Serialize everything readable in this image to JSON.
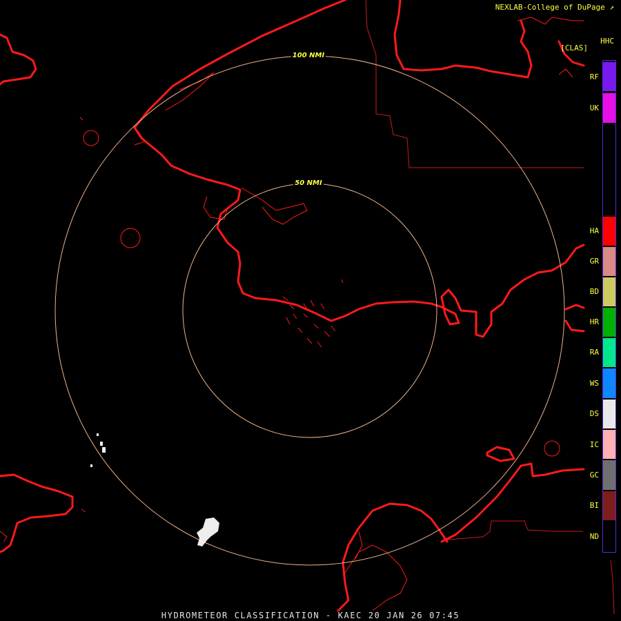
{
  "header": {
    "credit": "NEXLAB-College of DuPage",
    "credit_icon": "external-link-icon",
    "product_code": "HHC",
    "class_label": "[CLAS]"
  },
  "range_rings": [
    {
      "label": "50 NMI",
      "radius_nmi": 50
    },
    {
      "label": "100 NMI",
      "radius_nmi": 100
    }
  ],
  "legend": [
    {
      "code": "RF",
      "color": "#7a18f0"
    },
    {
      "code": "UK",
      "color": "#e60fe6"
    },
    {
      "code": "HA",
      "color": "#ff0000"
    },
    {
      "code": "GR",
      "color": "#d88a85"
    },
    {
      "code": "BD",
      "color": "#cccb60"
    },
    {
      "code": "HR",
      "color": "#00b000"
    },
    {
      "code": "RA",
      "color": "#00e88c"
    },
    {
      "code": "WS",
      "color": "#0d86ff"
    },
    {
      "code": "DS",
      "color": "#e8e8e8"
    },
    {
      "code": "IC",
      "color": "#ffb1b1"
    },
    {
      "code": "GC",
      "color": "#6f6f6f"
    },
    {
      "code": "BI",
      "color": "#7e1d1d"
    },
    {
      "code": "ND",
      "color": "#000000"
    }
  ],
  "footer": "HYDROMETEOR CLASSIFICATION - KAEC 20 JAN 26 07:45",
  "colors": {
    "coastline": "#ff1a1a",
    "border": "#cc1a1a",
    "ring": "#f0b48c",
    "ring_label": "#ffff44",
    "echo": "#eeeeee"
  }
}
